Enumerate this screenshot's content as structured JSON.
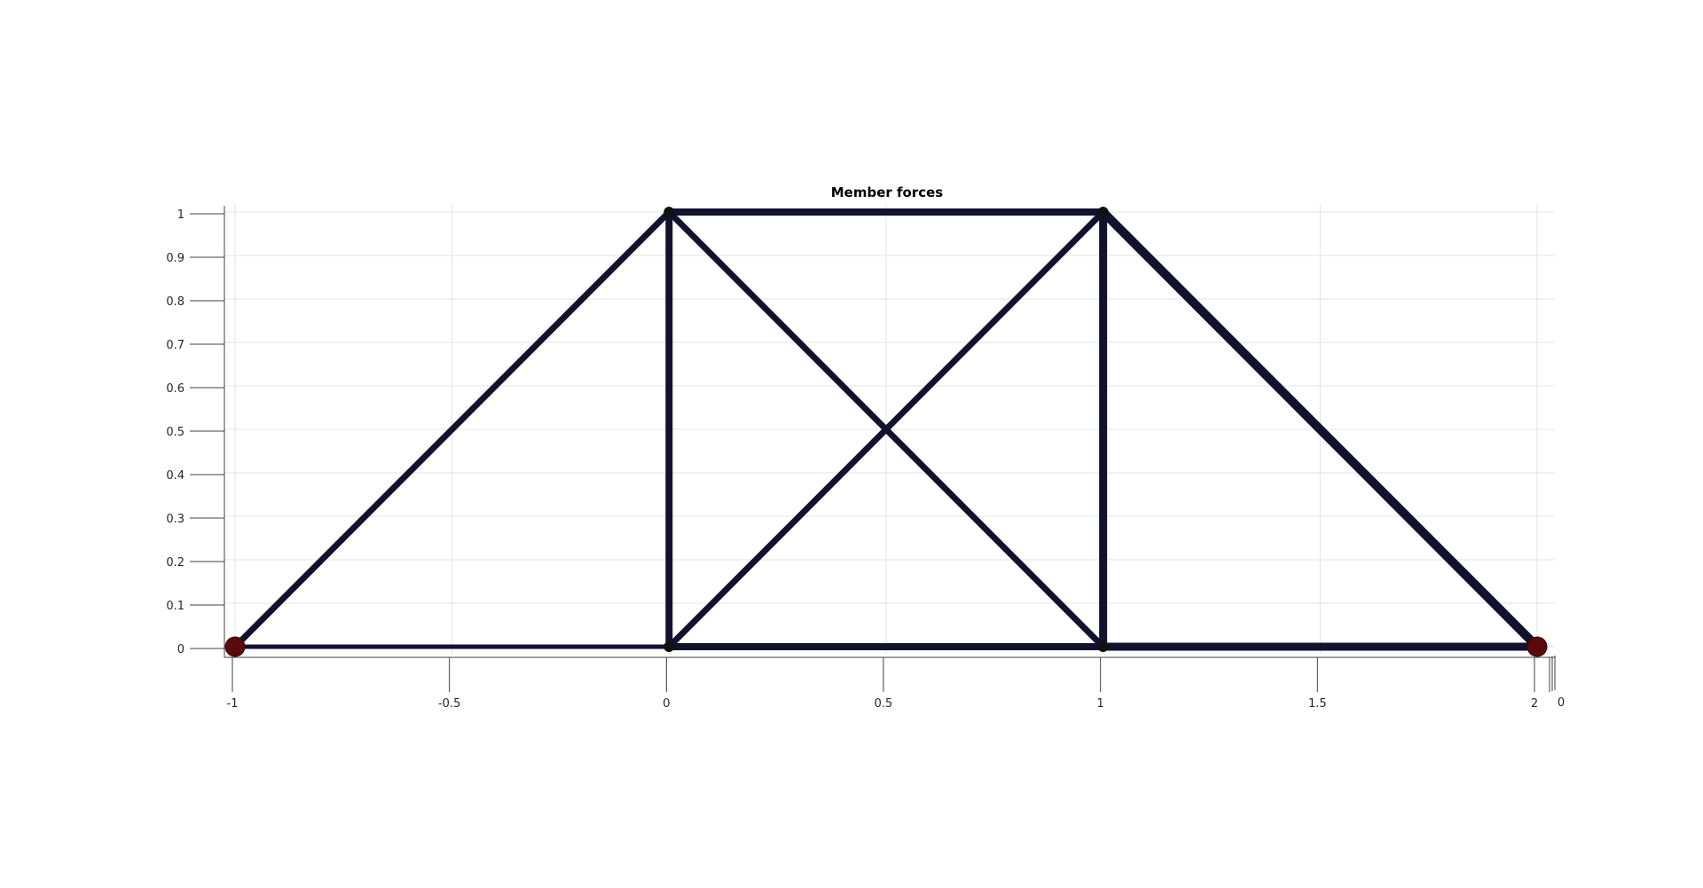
{
  "chart_data": {
    "type": "truss",
    "title": "Member forces",
    "xlim": [
      -1,
      2
    ],
    "ylim": [
      0,
      1
    ],
    "x_ticks": [
      -1,
      -0.5,
      0,
      0.5,
      1,
      1.5,
      2
    ],
    "x_tick_labels": [
      "-1",
      "-0.5",
      "0",
      "0.5",
      "1",
      "1.5",
      "2"
    ],
    "y_ticks": [
      0,
      0.1,
      0.2,
      0.3,
      0.4,
      0.5,
      0.6,
      0.7,
      0.8,
      0.9,
      1
    ],
    "y_tick_labels": [
      "0",
      "0.1",
      "0.2",
      "0.3",
      "0.4",
      "0.5",
      "0.6",
      "0.7",
      "0.8",
      "0.9",
      "1"
    ],
    "z_tick_labels": [
      "0"
    ],
    "grid": true,
    "nodes": [
      {
        "id": 1,
        "x": -1,
        "y": 0,
        "support": true
      },
      {
        "id": 2,
        "x": 0,
        "y": 0,
        "support": false
      },
      {
        "id": 3,
        "x": 1,
        "y": 0,
        "support": false
      },
      {
        "id": 4,
        "x": 2,
        "y": 0,
        "support": true
      },
      {
        "id": 5,
        "x": 0,
        "y": 1,
        "support": false
      },
      {
        "id": 6,
        "x": 1,
        "y": 1,
        "support": false
      }
    ],
    "members": [
      {
        "from": 1,
        "to": 2,
        "width": 5
      },
      {
        "from": 2,
        "to": 3,
        "width": 8
      },
      {
        "from": 3,
        "to": 4,
        "width": 9
      },
      {
        "from": 1,
        "to": 5,
        "width": 7
      },
      {
        "from": 5,
        "to": 6,
        "width": 8
      },
      {
        "from": 6,
        "to": 4,
        "width": 10
      },
      {
        "from": 2,
        "to": 5,
        "width": 8
      },
      {
        "from": 3,
        "to": 6,
        "width": 9
      },
      {
        "from": 5,
        "to": 3,
        "width": 7
      },
      {
        "from": 2,
        "to": 6,
        "width": 7
      }
    ],
    "colors": {
      "member": "#12112e",
      "node": "#111111",
      "support": "#5a0a0a"
    }
  }
}
